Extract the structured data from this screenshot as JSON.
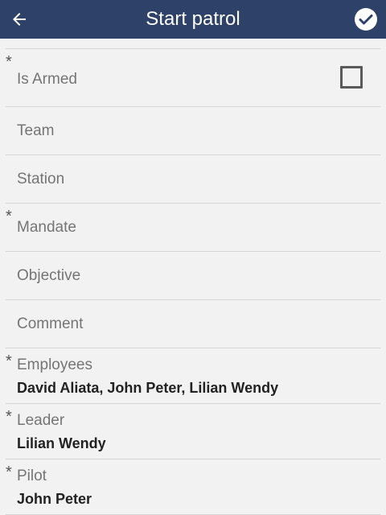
{
  "header": {
    "title": "Start patrol",
    "back_icon": "arrow-left-icon",
    "confirm_icon": "check-circle-icon"
  },
  "fields": {
    "is_armed": {
      "label": "Is Armed",
      "required": "*",
      "checked": false
    },
    "team": {
      "label": "Team"
    },
    "station": {
      "label": "Station"
    },
    "mandate": {
      "label": "Mandate",
      "required": "*"
    },
    "objective": {
      "label": "Objective"
    },
    "comment": {
      "label": "Comment"
    },
    "employees": {
      "label": "Employees",
      "required": "*",
      "value": "David Aliata, John Peter, Lilian Wendy"
    },
    "leader": {
      "label": "Leader",
      "required": "*",
      "value": "Lilian Wendy"
    },
    "pilot": {
      "label": "Pilot",
      "required": "*",
      "value": "John Peter"
    }
  },
  "colors": {
    "appbar": "#2e4169",
    "background": "#f2f2f2",
    "divider": "#d6d6d6"
  }
}
